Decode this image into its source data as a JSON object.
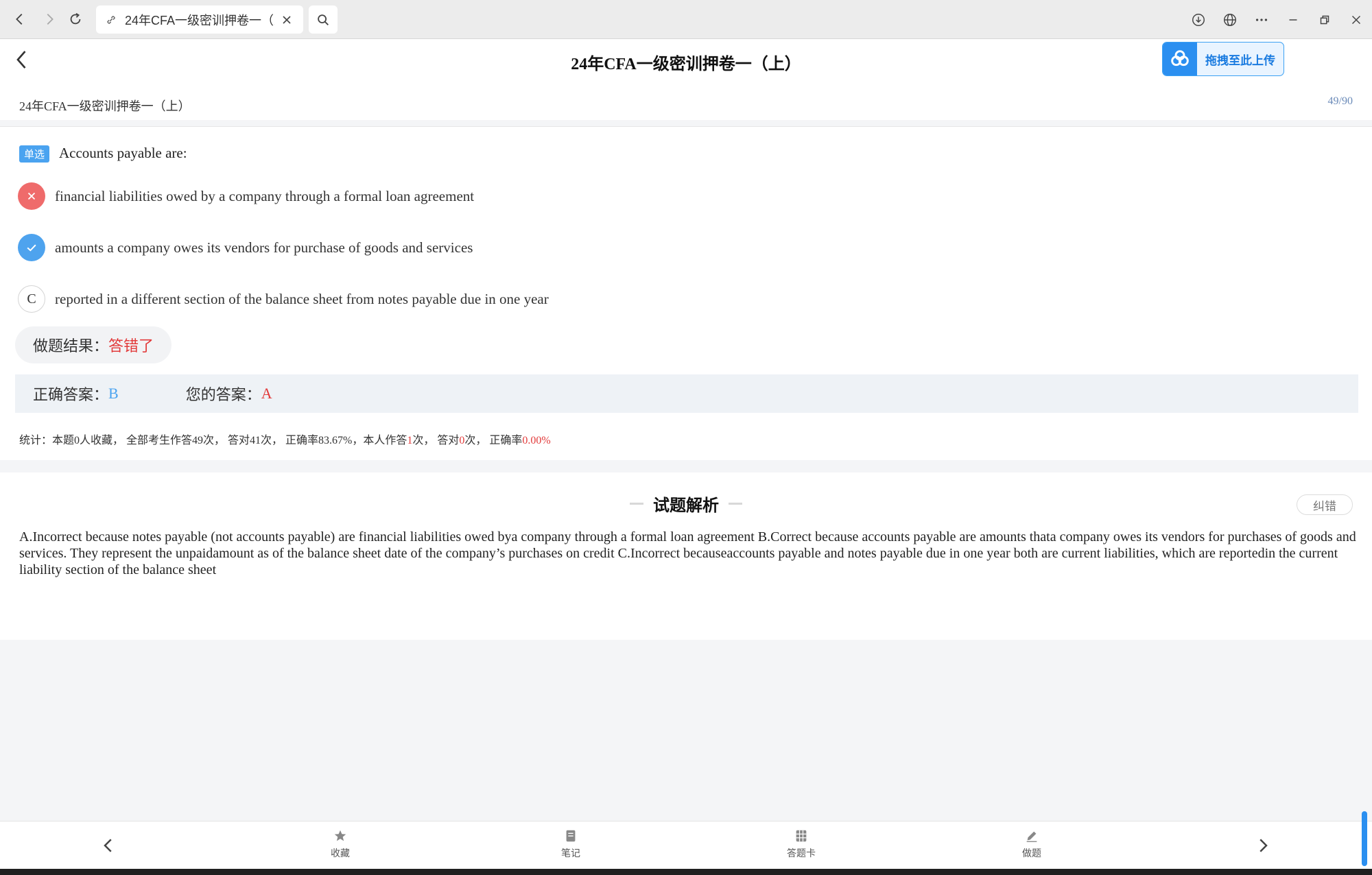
{
  "browser": {
    "tab_title": "24年CFA一级密训押卷一（上）",
    "icons": [
      "back-icon",
      "forward-icon",
      "reload-icon",
      "link-icon",
      "close-icon",
      "search-icon",
      "download-icon",
      "globe-icon",
      "more-icon",
      "minimize-icon",
      "restore-icon",
      "window-close-icon"
    ]
  },
  "header": {
    "title": "24年CFA一级密训押卷一（上）",
    "upload_label": "拖拽至此上传",
    "subtitle": "24年CFA一级密训押卷一（上）",
    "progress": "49/90"
  },
  "question": {
    "type_badge": "单选",
    "text": "Accounts payable are:",
    "options": [
      {
        "state": "wrong",
        "mark": "",
        "text": "financial liabilities owed by a company through a formal loan agreement"
      },
      {
        "state": "right",
        "mark": "",
        "text": "amounts a company owes its vendors for purchase of goods and services"
      },
      {
        "state": "plain",
        "mark": "C",
        "text": "reported in a different section of the balance sheet from notes payable due in one year"
      }
    ],
    "result_label": "做题结果：",
    "result_value": "答错了",
    "correct_label": "正确答案：",
    "correct_value": "B",
    "your_label": "您的答案：",
    "your_value": "A",
    "stats": {
      "prefix": "统计：本题0人收藏， 全部考生作答49次， 答对41次， 正确率83.67%，本人作答",
      "self_count": "1",
      "mid1": "次， 答对",
      "self_correct": "0",
      "mid2": "次， 正确率",
      "self_rate": "0.00%"
    }
  },
  "analysis": {
    "title": "试题解析",
    "report_label": "纠错",
    "body": "A.Incorrect because notes payable (not accounts payable) are financial liabilities owed bya company through a formal loan agreement B.Correct because accounts payable are amounts thata company owes its vendors for purchases of goods and services. They represent the unpaidamount as of the balance sheet date of the company’s purchases on credit C.Incorrect becauseaccounts payable and notes payable due in one year both are current liabilities, which are reportedin the current liability section of the balance sheet"
  },
  "bottom_nav": {
    "items": [
      {
        "label": "收藏",
        "icon": "star-icon"
      },
      {
        "label": "笔记",
        "icon": "note-icon"
      },
      {
        "label": "答题卡",
        "icon": "answer-card-icon"
      },
      {
        "label": "做题",
        "icon": "pencil-icon"
      }
    ]
  },
  "colors": {
    "accent": "#4aa3f0",
    "error": "#e23a3a",
    "wrong_mark": "#ef6b6b",
    "right_mark": "#4ea3ee"
  }
}
